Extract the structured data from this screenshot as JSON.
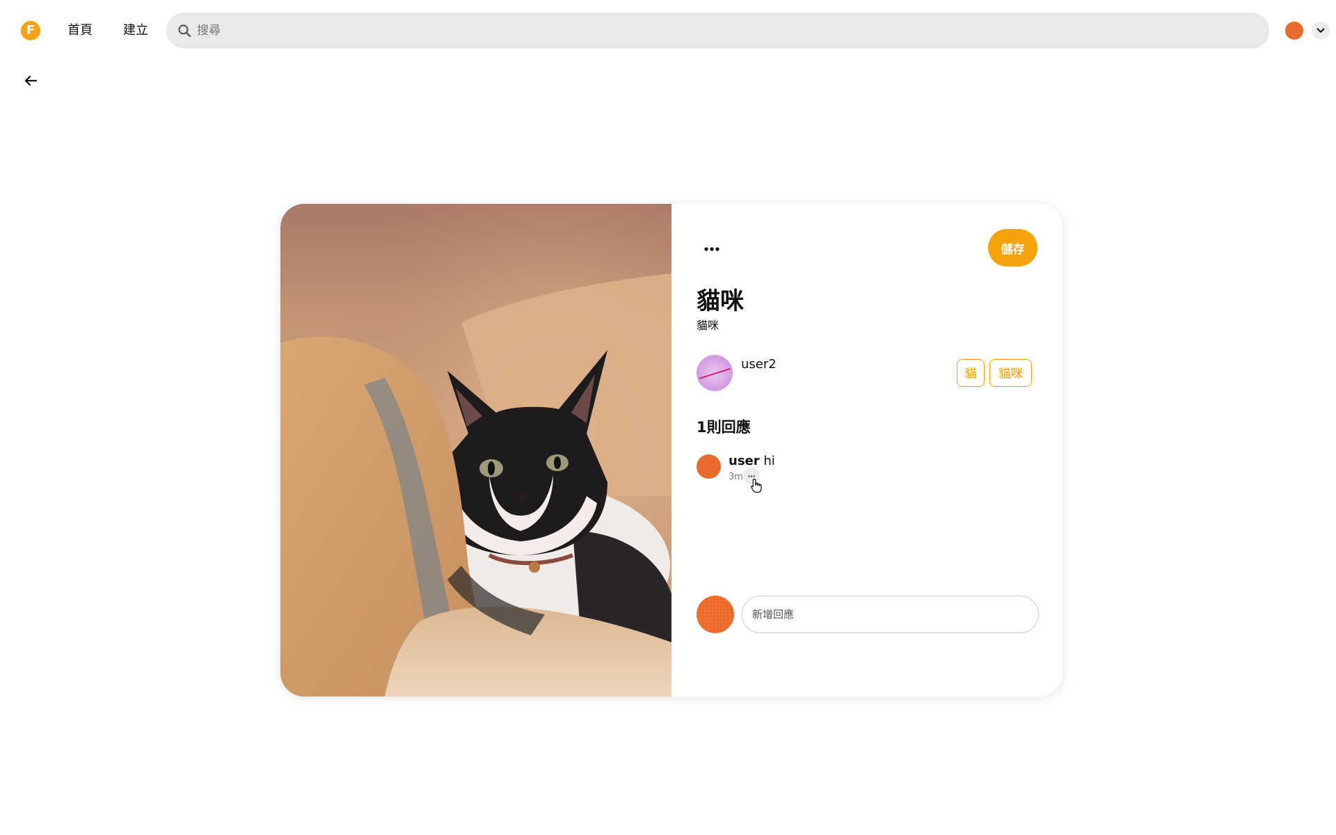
{
  "app": {
    "logo_letter": "F",
    "brand_color": "#f5a20c"
  },
  "nav": {
    "home_label": "首頁",
    "create_label": "建立"
  },
  "search": {
    "placeholder": "搜尋",
    "icon": "search-icon"
  },
  "account": {
    "avatar_color": "#ea6a2d",
    "menu_icon": "chevron-down-icon"
  },
  "back": {
    "icon": "arrow-left-icon"
  },
  "pin": {
    "image_alt": "cat lying on a fluffy blanket",
    "more_icon": "ellipsis-icon",
    "save_label": "儲存",
    "title": "貓咪",
    "description": "貓咪",
    "creator": {
      "name": "user2"
    },
    "tags": [
      "貓",
      "貓咪"
    ]
  },
  "comments": {
    "count_label": "1則回應",
    "items": [
      {
        "author": "user",
        "text": "hi",
        "time": "3m",
        "more_icon": "ellipsis-icon"
      }
    ],
    "input_placeholder": "新增回應"
  }
}
